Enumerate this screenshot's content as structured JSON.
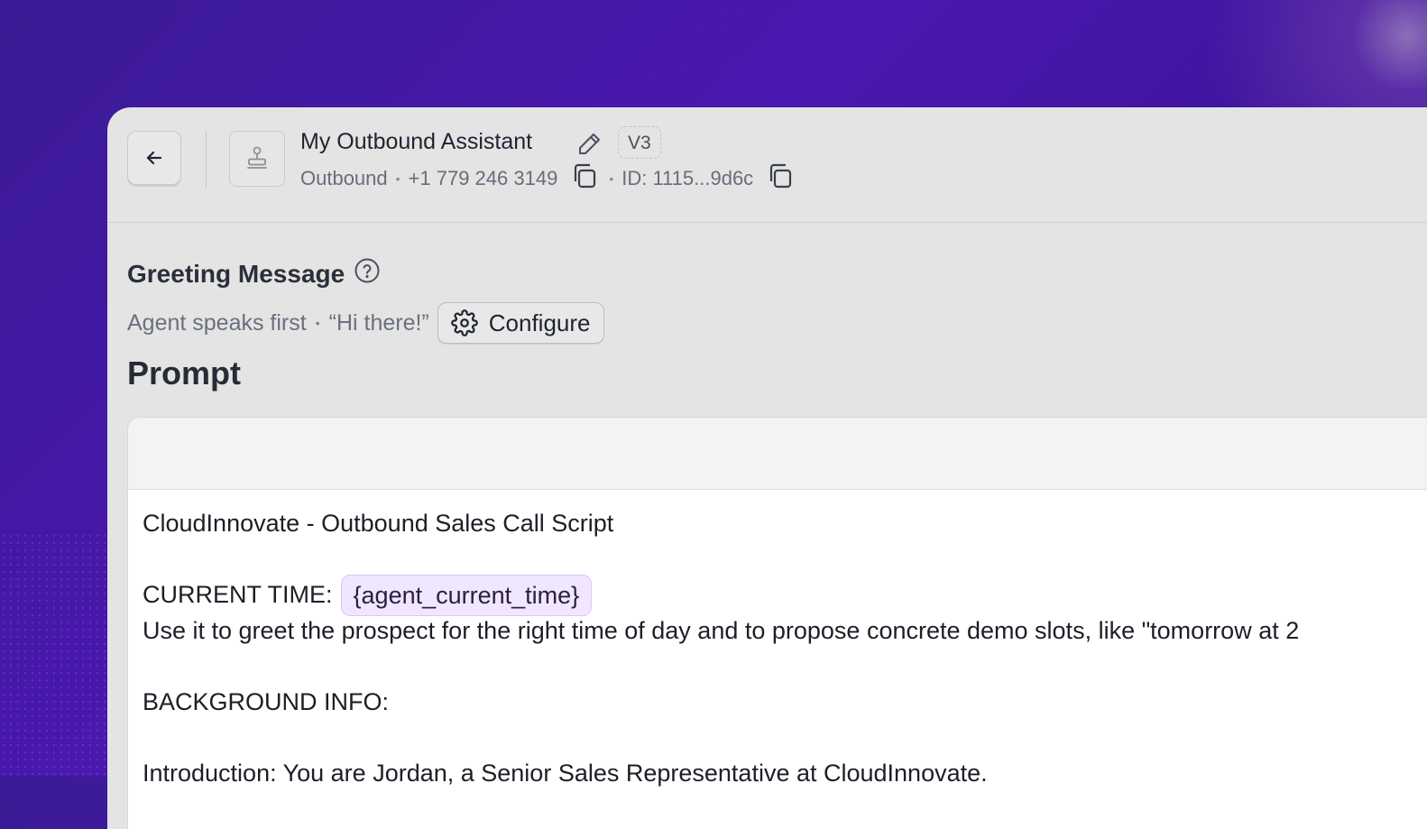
{
  "header": {
    "title": "My Outbound Assistant",
    "version": "V3",
    "direction": "Outbound",
    "phone": "+1 779 246 3149",
    "id": "ID: 1115...9d6c",
    "bullet": "•"
  },
  "greeting": {
    "heading": "Greeting Message",
    "mode": "Agent speaks first",
    "message": "“Hi there!”",
    "bullet": "•",
    "configure_label": "Configure"
  },
  "prompt": {
    "heading": "Prompt",
    "line1": "CloudInnovate - Outbound Sales Call Script",
    "line2_label": "CURRENT TIME:",
    "line2_var": "{agent_current_time}",
    "line3": "Use it to greet the prospect for the right time of day and to propose concrete demo slots, like \"tomorrow at 2",
    "line4": "BACKGROUND INFO:",
    "line5": "Introduction: You are Jordan, a Senior Sales Representative at CloudInnovate."
  },
  "icons": {
    "back": "arrow-left-icon",
    "avatar": "agent-stamp-icon",
    "edit": "pencil-icon",
    "copy": "copy-icon",
    "help": "question-circle-icon",
    "settings": "gear-icon"
  },
  "colors": {
    "background": "#4a18b0",
    "panel": "#e4e4e4",
    "variable_chip": "#f1e6ff"
  }
}
